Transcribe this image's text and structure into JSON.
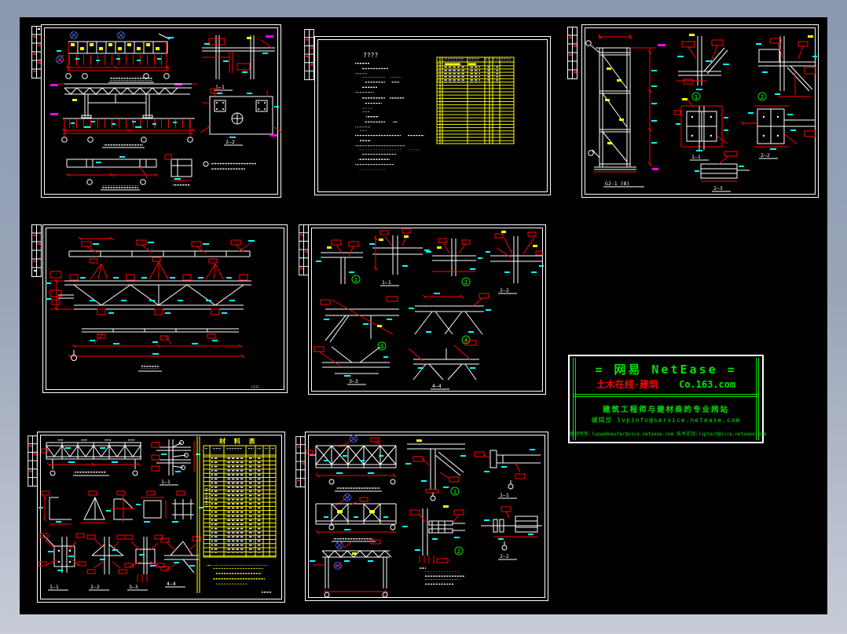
{
  "window": {
    "background_top": "#8a98b0",
    "background_bottom": "#c7ccd7",
    "canvas_color": "#000000"
  },
  "palette": {
    "white": "#ffffff",
    "red": "#ff0000",
    "yellow": "#ffff00",
    "cyan": "#00ffff",
    "green": "#00e400",
    "magenta": "#ff00ff",
    "blue": "#4c5fd8"
  },
  "title_block": {
    "brand": "=  网易 NetEase  =",
    "portal_red": "土木在线·建筑",
    "portal_green": "Co.163.com",
    "slogan": "建筑工程师与建材商的专业网站",
    "editor_line": "编辑部  lvpinfo@service.netease.com",
    "copyright_line": "版权所有:lvpwebmaster@vice.netease.com  技术支持:lvptech@vice.netease.com"
  },
  "labels": {
    "p1": {
      "s1": "1—1",
      "s2": "2—2"
    },
    "p2": {
      "title": "????"
    },
    "p3": {
      "title": "GJ-1 (8)",
      "n1": "1",
      "n2": "2",
      "s1": "1—1",
      "s2": "2—2",
      "s3": "2—3"
    },
    "p5": {
      "n1": "1",
      "n2": "2",
      "n3": "3",
      "n4": "4",
      "s1": "1—1",
      "s2": "2—2",
      "s3": "3—3",
      "s4": "4—4"
    },
    "p7": {
      "table_title": "材 料 表",
      "s1": "1—1",
      "s2": "2—2",
      "s3": "3—3",
      "s4": "4—4"
    },
    "p8": {
      "n1": "1",
      "n2": "2",
      "s1": "1—1",
      "s2": "2—2"
    }
  }
}
